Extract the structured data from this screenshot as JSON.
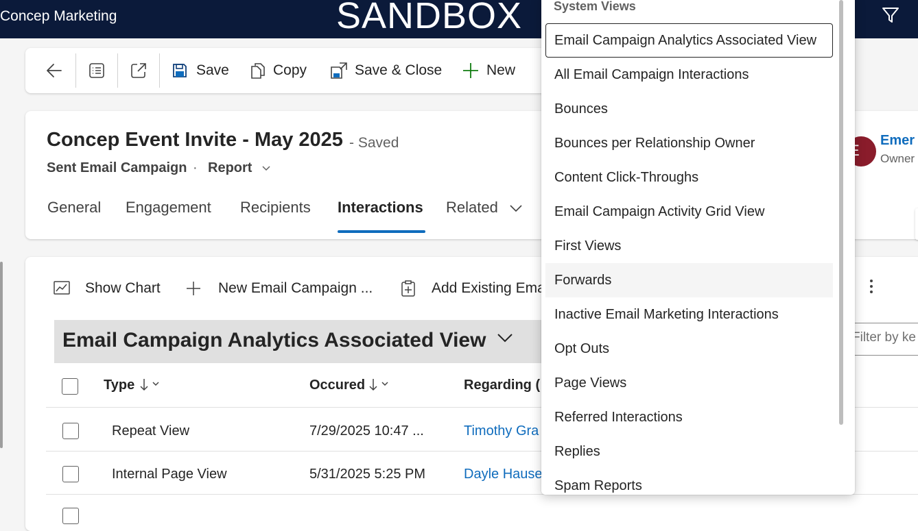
{
  "header": {
    "app_title": "Concep Marketing",
    "environment": "SANDBOX"
  },
  "command_bar": {
    "save": "Save",
    "copy": "Copy",
    "save_close": "Save & Close",
    "new": "New"
  },
  "record": {
    "title": "Concep Event Invite - May 2025",
    "status": "- Saved",
    "entity": "Sent Email Campaign",
    "separator": "·",
    "form": "Report",
    "owner_initial": "E",
    "owner_name": "Emer",
    "owner_label": "Owner"
  },
  "tabs": [
    {
      "label": "General"
    },
    {
      "label": "Engagement"
    },
    {
      "label": "Recipients"
    },
    {
      "label": "Interactions"
    },
    {
      "label": "Related"
    }
  ],
  "grid": {
    "commands": {
      "show_chart": "Show Chart",
      "new_record": "New Email Campaign ...",
      "add_existing": "Add Existing Ema"
    },
    "view_name": "Email Campaign Analytics Associated View",
    "filter_placeholder": "Filter by ke",
    "columns": [
      "Type",
      "Occured",
      "Regarding ("
    ],
    "rows": [
      {
        "type": "Repeat View",
        "occured": "7/29/2025 10:47 ...",
        "regarding": "Timothy Gra"
      },
      {
        "type": "Internal Page View",
        "occured": "5/31/2025 5:25 PM",
        "regarding": "Dayle Hause"
      }
    ]
  },
  "view_dropdown": {
    "group_label": "System Views",
    "items": [
      "Email Campaign Analytics Associated View",
      "All Email Campaign Interactions",
      "Bounces",
      "Bounces per Relationship Owner",
      "Content Click-Throughs",
      "Email Campaign Activity Grid View",
      "First Views",
      "Forwards",
      "Inactive Email Marketing Interactions",
      "Opt Outs",
      "Page Views",
      "Referred Interactions",
      "Replies",
      "Spam Reports"
    ],
    "selected_index": 0,
    "hovered_index": 7
  },
  "colors": {
    "header_bg": "#0b1a3a",
    "accent": "#0f6cbd",
    "avatar": "#8a1c2b"
  }
}
